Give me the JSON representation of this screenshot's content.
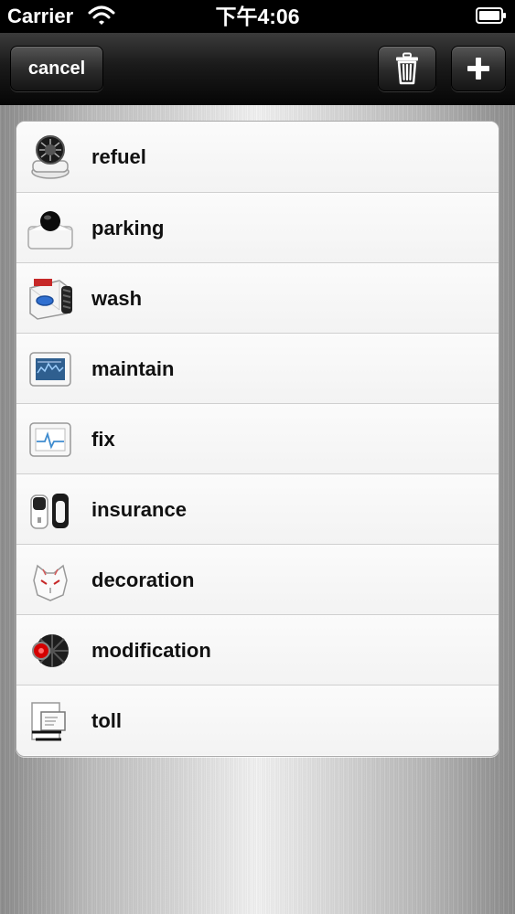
{
  "status_bar": {
    "carrier": "Carrier",
    "time": "下午4:06",
    "wifi_icon": "wifi-icon",
    "battery_icon": "battery-icon"
  },
  "nav_bar": {
    "cancel_label": "cancel",
    "trash_icon": "trash-icon",
    "add_icon": "plus-icon"
  },
  "items": [
    {
      "label": "refuel",
      "icon": "fuel-icon"
    },
    {
      "label": "parking",
      "icon": "parking-icon"
    },
    {
      "label": "wash",
      "icon": "wash-icon"
    },
    {
      "label": "maintain",
      "icon": "maintenance-icon"
    },
    {
      "label": "fix",
      "icon": "repair-icon"
    },
    {
      "label": "insurance",
      "icon": "insurance-icon"
    },
    {
      "label": "decoration",
      "icon": "decoration-icon"
    },
    {
      "label": "modification",
      "icon": "modification-icon"
    },
    {
      "label": "toll",
      "icon": "toll-icon"
    }
  ],
  "colors": {
    "nav_background": "#111111",
    "list_background": "#ffffff",
    "text": "#111111"
  }
}
